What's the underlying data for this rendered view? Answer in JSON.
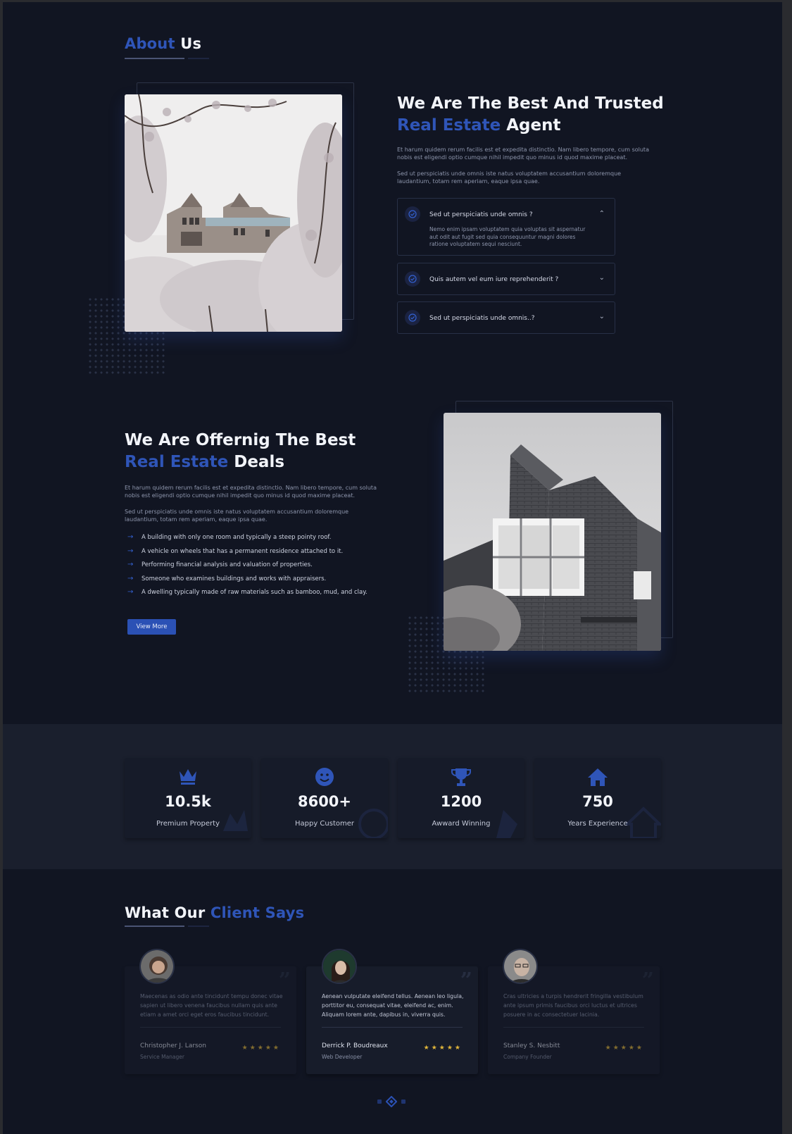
{
  "about": {
    "title_accent": "About",
    "title_rest": " Us",
    "heading_line1": "We Are The Best And Trusted",
    "heading_accent": "Real Estate",
    "heading_rest": " Agent",
    "para1": "Et harum quidem rerum facilis est et expedita distinctio. Nam libero tempore, cum soluta nobis est eligendi optio cumque nihil impedit quo minus id quod maxime placeat.",
    "para2": "Sed ut perspiciatis unde omnis iste natus voluptatem accusantium doloremque laudantium, totam rem aperiam, eaque ipsa quae.",
    "accordion": [
      {
        "question": "Sed ut perspiciatis unde omnis ?",
        "answer": "Nemo enim ipsam voluptatem quia voluptas sit aspernatur aut odit aut fugit sed quia consequuntur magni dolores ratione voluptatem sequi nesciunt.",
        "expanded": true
      },
      {
        "question": "Quis autem vel eum iure reprehenderit ?",
        "expanded": false
      },
      {
        "question": "Sed ut perspiciatis unde omnis..?",
        "expanded": false
      }
    ]
  },
  "offering": {
    "heading_line1": "We Are Offernig The Best",
    "heading_accent": "Real Estate",
    "heading_rest": " Deals",
    "para1": "Et harum quidem rerum facilis est et expedita distinctio. Nam libero tempore, cum soluta nobis est eligendi optio cumque nihil impedit quo minus id quod maxime placeat.",
    "para2": "Sed ut perspiciatis unde omnis iste natus voluptatem accusantium doloremque laudantium, totam rem aperiam, eaque ipsa quae.",
    "list": [
      "A building with only one room and typically a steep pointy roof.",
      "A vehicle on wheels that has a permanent residence attached to it.",
      "Performing financial analysis and valuation of properties.",
      "Someone who examines buildings and works with appraisers.",
      "A dwelling typically made of raw materials such as bamboo, mud, and clay."
    ],
    "button": "View More"
  },
  "stats": [
    {
      "icon": "crown-icon",
      "value": "10.5k",
      "label": "Premium Property"
    },
    {
      "icon": "smile-icon",
      "value": "8600+",
      "label": "Happy Customer"
    },
    {
      "icon": "trophy-icon",
      "value": "1200",
      "label": "Awward Winning"
    },
    {
      "icon": "home-icon",
      "value": "750",
      "label": "Years Experience"
    }
  ],
  "testimonials": {
    "title_rest": "What Our ",
    "title_accent": "Client Says",
    "items": [
      {
        "text": "Maecenas as odio ante tincidunt tempu donec vitae sapien ut libero venena faucibus nullam quis ante etiam a amet orci eget eros faucibus tincidunt.",
        "name": "Christopher J. Larson",
        "role": "Service Manager",
        "stars": "★★★★★"
      },
      {
        "text": "Aenean vulputate eleifend tellus. Aenean leo ligula, porttitor eu, consequat vitae, eleifend ac, enim. Aliquam lorem ante, dapibus in, viverra quis.",
        "name": "Derrick P. Boudreaux",
        "role": "Web Developer",
        "stars": "★★★★★"
      },
      {
        "text": "Cras ultricies a turpis hendrerit fringilla vestibulum ante ipsum primis faucibus orci luctus et ultrices posuere in ac consectetuer lacinia.",
        "name": "Stanley S. Nesbitt",
        "role": "Company Founder",
        "stars": "★★★★★"
      }
    ]
  },
  "colors": {
    "accent": "#2f55b8",
    "background": "#111522",
    "band": "#1a1f2d",
    "star": "#e0b53a"
  }
}
